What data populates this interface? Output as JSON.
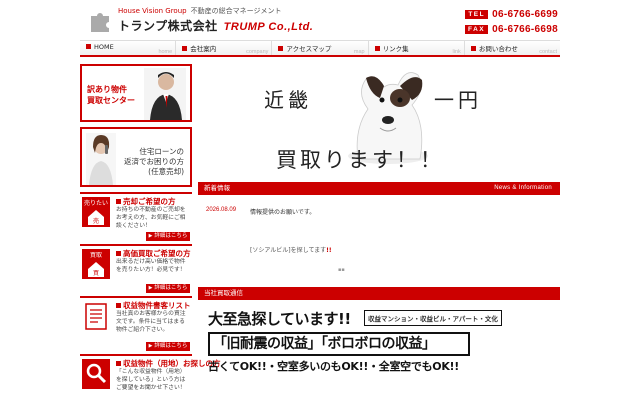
{
  "header": {
    "tagline_en": "House Vision Group",
    "tagline_jp": "不動産の総合マネージメント",
    "company_jp": "トランプ株式会社",
    "company_en": "TRUMP Co.,Ltd.",
    "tel_label": "TEL",
    "tel_number": "06-6766-6699",
    "fax_label": "FAX",
    "fax_number": "06-6766-6698"
  },
  "nav": [
    {
      "label": "HOME",
      "sub": "home"
    },
    {
      "label": "会社案内",
      "sub": "company"
    },
    {
      "label": "アクセスマップ",
      "sub": "map"
    },
    {
      "label": "リンク集",
      "sub": "link"
    },
    {
      "label": "お問い合わせ",
      "sub": "contact"
    }
  ],
  "sidebar": {
    "banner1": {
      "line1": "訳あり物件",
      "line2": "買取センター"
    },
    "banner2": {
      "line1": "住宅ローンの",
      "line2": "返済でお困りの方",
      "line3": "(任意売却)"
    },
    "services": [
      {
        "icon_label": "売りたい",
        "title": "売却ご希望の方",
        "desc": "お持ちの不動産のご売却をお考えの方、お気軽にご相談ください！",
        "more": "詳細はこちら"
      },
      {
        "icon_label": "買取",
        "title": "高価買取ご希望の方",
        "desc": "出来るだけ高い価格で物件を売りたい方！必見です！",
        "more": "詳細はこちら"
      },
      {
        "icon_label": "",
        "title": "収益物件書客リスト",
        "desc": "当社真のお客様からの買注文です。条件に当てはまる物件ご紹介下さい。",
        "more": "詳細はこちら"
      },
      {
        "icon_label": "",
        "title": "収益物件（用地）お探しの方",
        "desc": "「こんな収益物件（用地）を探している」という方はご要望をお聞かせ下さい！",
        "more": ""
      }
    ]
  },
  "hero": {
    "t1": "近畿",
    "t2": "一円",
    "t3": "買取ります！！"
  },
  "news": {
    "heading": "新着情報",
    "heading_en": "News & Information",
    "date": "2026.08.09",
    "item1": "情報提供のお願いです。",
    "item2": "[ソシアルビル]を探してます",
    "item2_mark": "!!",
    "dots": "▪▪"
  },
  "purchase": {
    "heading": "当社買取通信",
    "line1": "大至急探しています!!",
    "badge": "収益マンション・収益ビル・アパート・文化",
    "line2": "「旧耐震の収益」「ボロボロの収益」",
    "line3": "古くてOK!!・空室多いのもOK!!・全室空でもOK!!"
  },
  "colors": {
    "accent": "#cc0000"
  }
}
